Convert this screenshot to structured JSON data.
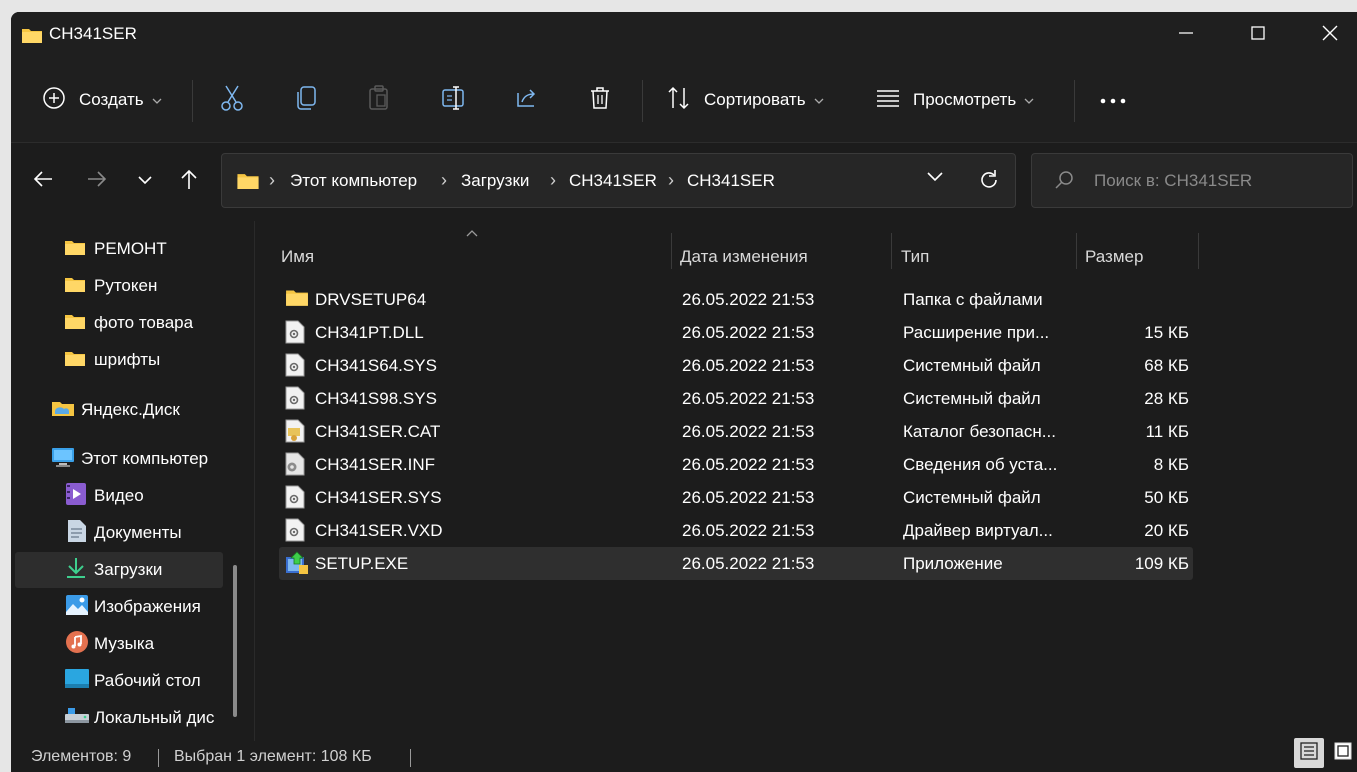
{
  "window": {
    "title": "CH341SER",
    "controls": {
      "minimize": "minimize-icon",
      "maximize": "maximize-icon",
      "close": "close-icon"
    }
  },
  "toolbar": {
    "create_label": "Создать",
    "sort_label": "Сортировать",
    "view_label": "Просмотреть",
    "icons": [
      "plus-circle-icon",
      "cut-icon",
      "copy-icon",
      "paste-icon",
      "rename-icon",
      "share-icon",
      "delete-icon",
      "sort-icon",
      "view-icon",
      "more-icon"
    ]
  },
  "address": {
    "crumbs": [
      "Этот компьютер",
      "Загрузки",
      "CH341SER",
      "CH341SER"
    ]
  },
  "search": {
    "placeholder": "Поиск в: CH341SER"
  },
  "sidebar": {
    "items": [
      {
        "label": "РЕМОНТ",
        "icon": "folder-icon"
      },
      {
        "label": "Рутокен",
        "icon": "folder-icon"
      },
      {
        "label": "фото товара",
        "icon": "folder-icon"
      },
      {
        "label": "шрифты",
        "icon": "folder-icon"
      },
      {
        "label": "Яндекс.Диск",
        "icon": "yandex-disk-icon"
      },
      {
        "label": "Этот компьютер",
        "icon": "computer-icon"
      },
      {
        "label": "Видео",
        "icon": "video-icon"
      },
      {
        "label": "Документы",
        "icon": "documents-icon"
      },
      {
        "label": "Загрузки",
        "icon": "downloads-icon"
      },
      {
        "label": "Изображения",
        "icon": "pictures-icon"
      },
      {
        "label": "Музыка",
        "icon": "music-icon"
      },
      {
        "label": "Рабочий стол",
        "icon": "desktop-icon"
      },
      {
        "label": "Локальный дис",
        "icon": "local-disk-icon"
      }
    ]
  },
  "filelist": {
    "columns": {
      "name": "Имя",
      "date": "Дата изменения",
      "type": "Тип",
      "size": "Размер"
    },
    "rows": [
      {
        "name": "DRVSETUP64",
        "date": "26.05.2022 21:53",
        "type": "Папка с файлами",
        "size": "",
        "icon": "folder-icon"
      },
      {
        "name": "CH341PT.DLL",
        "date": "26.05.2022 21:53",
        "type": "Расширение при...",
        "size": "15 КБ",
        "icon": "system-file-icon"
      },
      {
        "name": "CH341S64.SYS",
        "date": "26.05.2022 21:53",
        "type": "Системный файл",
        "size": "68 КБ",
        "icon": "system-file-icon"
      },
      {
        "name": "CH341S98.SYS",
        "date": "26.05.2022 21:53",
        "type": "Системный файл",
        "size": "28 КБ",
        "icon": "system-file-icon"
      },
      {
        "name": "CH341SER.CAT",
        "date": "26.05.2022 21:53",
        "type": "Каталог безопасн...",
        "size": "11 КБ",
        "icon": "security-catalog-icon"
      },
      {
        "name": "CH341SER.INF",
        "date": "26.05.2022 21:53",
        "type": "Сведения об уста...",
        "size": "8 КБ",
        "icon": "setup-info-icon"
      },
      {
        "name": "CH341SER.SYS",
        "date": "26.05.2022 21:53",
        "type": "Системный файл",
        "size": "50 КБ",
        "icon": "system-file-icon"
      },
      {
        "name": "CH341SER.VXD",
        "date": "26.05.2022 21:53",
        "type": "Драйвер виртуал...",
        "size": "20 КБ",
        "icon": "system-file-icon"
      },
      {
        "name": "SETUP.EXE",
        "date": "26.05.2022 21:53",
        "type": "Приложение",
        "size": "109 КБ",
        "icon": "setup-exe-icon"
      }
    ]
  },
  "status": {
    "items_count": "Элементов: 9",
    "selection": "Выбран 1 элемент: 108 КБ"
  },
  "colors": {
    "background": "#1c1c1c",
    "folder": "#f5c542",
    "selected": "#2f2f2f",
    "accent": "#4cc2ff"
  }
}
